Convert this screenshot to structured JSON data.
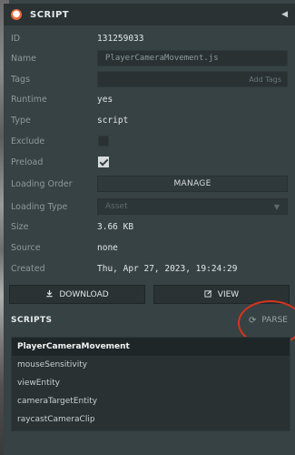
{
  "header": {
    "badge": "●",
    "title": "SCRIPT",
    "collapse_icon": "◀"
  },
  "fields": {
    "id": {
      "label": "ID",
      "value": "131259033"
    },
    "name": {
      "label": "Name",
      "value": "PlayerCameraMovement.js"
    },
    "tags": {
      "label": "Tags",
      "placeholder": "Add Tags"
    },
    "runtime": {
      "label": "Runtime",
      "value": "yes"
    },
    "type": {
      "label": "Type",
      "value": "script"
    },
    "exclude": {
      "label": "Exclude",
      "checked": false
    },
    "preload": {
      "label": "Preload",
      "checked": true
    },
    "loading_order": {
      "label": "Loading Order",
      "button": "MANAGE"
    },
    "loading_type": {
      "label": "Loading Type",
      "value": "Asset"
    },
    "size": {
      "label": "Size",
      "value": "3.66 KB"
    },
    "source": {
      "label": "Source",
      "value": "none"
    },
    "created": {
      "label": "Created",
      "value": "Thu, Apr 27, 2023, 19:24:29"
    }
  },
  "actions": {
    "download": {
      "label": "DOWNLOAD",
      "icon": "download-icon"
    },
    "view": {
      "label": "VIEW",
      "icon": "edit-icon"
    }
  },
  "scripts": {
    "title": "SCRIPTS",
    "parse_label": "PARSE",
    "items": [
      "PlayerCameraMovement",
      "mouseSensitivity",
      "viewEntity",
      "cameraTargetEntity",
      "raycastCameraClip"
    ]
  },
  "colors": {
    "accent": "#e8683a",
    "annotation": "#d6341e"
  }
}
